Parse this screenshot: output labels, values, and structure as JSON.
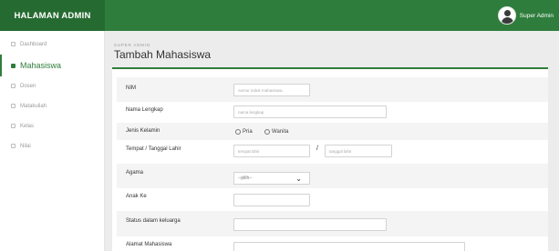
{
  "header": {
    "brand": "HALAMAN ADMIN",
    "user_name": "Super Admin"
  },
  "sidebar": {
    "items": [
      {
        "label": "Dashboard",
        "icon": "home-icon",
        "active": false
      },
      {
        "label": "Mahasiswa",
        "icon": "users-icon",
        "active": true
      },
      {
        "label": "Dosen",
        "icon": "teacher-icon",
        "active": false
      },
      {
        "label": "Matakuliah",
        "icon": "book-icon",
        "active": false
      },
      {
        "label": "Kelas",
        "icon": "class-icon",
        "active": false
      },
      {
        "label": "Nilai",
        "icon": "score-icon",
        "active": false
      }
    ]
  },
  "main": {
    "subtitle": "SUPER ADMIN",
    "title": "Tambah Mahasiswa"
  },
  "form": {
    "nim": {
      "label": "NIM",
      "placeholder": "nomor induk mahasiswa"
    },
    "nama": {
      "label": "Nama Lengkap",
      "placeholder": "nama lengkap"
    },
    "jenis_kelamin": {
      "label": "Jenis Kelamin",
      "options": [
        "Pria",
        "Wanita"
      ]
    },
    "ttl": {
      "label": "Tempat / Tanggal Lahir",
      "tempat_placeholder": "tempat lahir",
      "separator": "/",
      "tanggal_placeholder": "tanggal lahir"
    },
    "agama": {
      "label": "Agama",
      "selected": "--pilih--"
    },
    "anak_ke": {
      "label": "Anak Ke",
      "value": ""
    },
    "status": {
      "label": "Status dalam keluarga",
      "value": ""
    },
    "alamat": {
      "label": "Alamat Mahasiswa",
      "value": ""
    }
  },
  "colors": {
    "accent": "#2f7d3c",
    "brand_bg": "#256b31"
  }
}
